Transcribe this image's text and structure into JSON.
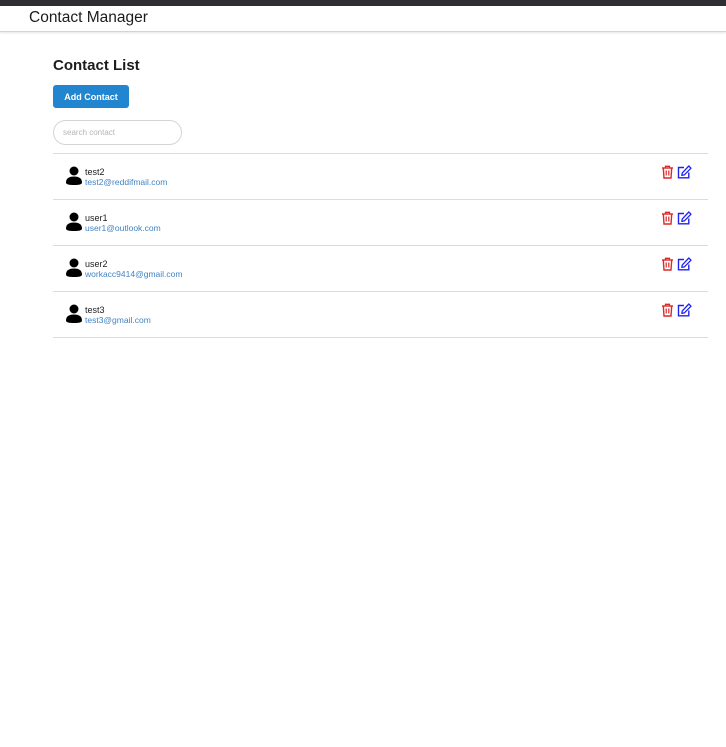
{
  "header": {
    "title": "Contact Manager"
  },
  "page": {
    "heading": "Contact List",
    "add_button_label": "Add Contact",
    "search": {
      "placeholder": "search contact",
      "value": ""
    }
  },
  "contacts": [
    {
      "name": "test2",
      "email": "test2@reddifmail.com"
    },
    {
      "name": "user1",
      "email": "user1@outlook.com"
    },
    {
      "name": "user2",
      "email": "workacc9414@gmail.com"
    },
    {
      "name": "test3",
      "email": "test3@gmail.com"
    }
  ],
  "icons": {
    "avatar": "user-icon",
    "delete": "trash-icon",
    "edit": "edit-icon"
  },
  "colors": {
    "top_strip": "#2f2f33",
    "primary_button": "#2185d0",
    "link": "#4183c4",
    "delete_icon": "#db2828",
    "edit_icon": "#2222ee"
  }
}
